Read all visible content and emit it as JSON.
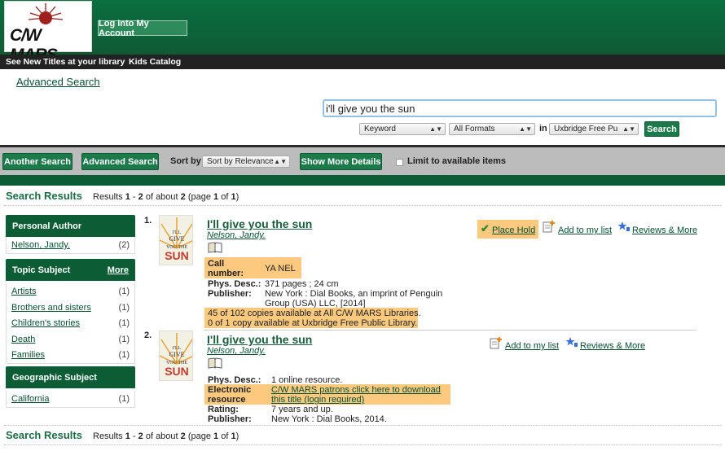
{
  "header": {
    "logo_text": "C/W MARS",
    "login_button": "Log Into My Account"
  },
  "nav": {
    "new_titles": "See New Titles at your library",
    "kids_catalog": "Kids Catalog"
  },
  "advanced_search_link": "Advanced Search",
  "search": {
    "query": "i'll give you the sun",
    "search_type": "Keyword",
    "format": "All Formats",
    "in_label": "in",
    "library": "Uxbridge Free Pu",
    "search_button": "Search"
  },
  "toolbar": {
    "another_search": "Another Search",
    "advanced_search": "Advanced Search",
    "sort_label": "Sort by",
    "sort_value": "Sort by Relevance",
    "show_more_details": "Show More Details",
    "limit_label": "Limit to available items"
  },
  "results_header": {
    "title": "Search Results",
    "prefix": "Results",
    "from": "1",
    "dash": " - ",
    "to": "2",
    "of_about": " of about ",
    "total": "2",
    "page_prefix": "  (page ",
    "page": "1",
    "of": " of ",
    "pages": "1",
    "page_suffix": ")"
  },
  "facets": [
    {
      "heading": "Personal Author",
      "more": "",
      "items": [
        {
          "label": "Nelson, Jandy.",
          "count": "(2)"
        }
      ]
    },
    {
      "heading": "Topic Subject",
      "more": "More",
      "items": [
        {
          "label": "Artists",
          "count": "(1)"
        },
        {
          "label": "Brothers and sisters",
          "count": "(1)"
        },
        {
          "label": "Children's stories",
          "count": "(1)"
        },
        {
          "label": "Death",
          "count": "(1)"
        },
        {
          "label": "Families",
          "count": "(1)"
        }
      ]
    },
    {
      "heading": "Geographic Subject",
      "more": "",
      "items": [
        {
          "label": "California",
          "count": "(1)"
        }
      ]
    }
  ],
  "results": [
    {
      "number": "1.",
      "cover_text": "I'LL GIVE YOU THE SUN",
      "title": "I'll give you the sun",
      "author": "Nelson, Jandy.",
      "call_number_label": "Call number:",
      "call_number": "YA NEL",
      "phys_desc_label": "Phys. Desc.:",
      "phys_desc": "371 pages ; 24 cm",
      "publisher_label": "Publisher:",
      "publisher": "New York : Dial Books, an imprint of Penguin Group (USA) LLC, [2014]",
      "availability_all": "45 of 102 copies available at All C/W MARS Libraries.",
      "availability_local": "0 of 1 copy available at Uxbridge Free Public Library.",
      "place_hold": "Place Hold",
      "add_to_list": "Add to my list",
      "reviews": "Reviews & More"
    },
    {
      "number": "2.",
      "cover_text": "I'LL GIVE YOU THE SUN",
      "title": "I'll give you the sun",
      "author": "Nelson, Jandy.",
      "phys_desc_label": "Phys. Desc.:",
      "phys_desc": "1 online resource.",
      "electronic_label": "Electronic resource",
      "electronic_link": "C/W MARS patrons click here to download this title (login required)",
      "rating_label": "Rating:",
      "rating": "7 years and up.",
      "publisher_label": "Publisher:",
      "publisher": "New York : Dial Books, 2014.",
      "add_to_list": "Add to my list",
      "reviews": "Reviews & More"
    }
  ],
  "colors": {
    "header_green": "#0a6f3f",
    "button_green": "#1c7a4a",
    "highlight": "#fcc97f",
    "toolbar_gray": "#bcbcbc"
  }
}
